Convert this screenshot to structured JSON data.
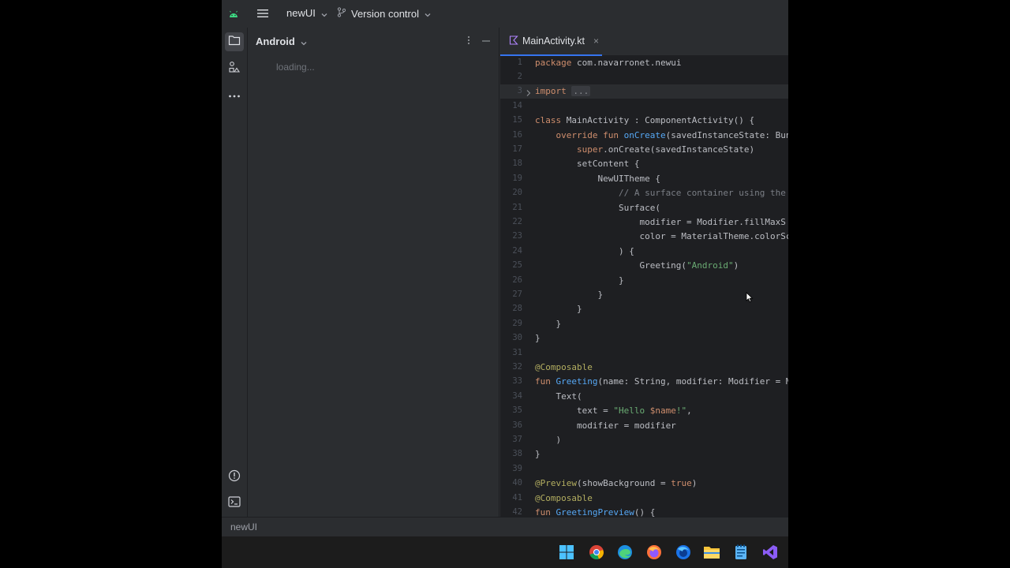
{
  "titlebar": {
    "project_name": "newUI",
    "vcs_label": "Version control"
  },
  "project_panel": {
    "view_label": "Android",
    "loading_text": "loading..."
  },
  "editor": {
    "tab_label": "MainActivity.kt",
    "tab_close": "×",
    "fold_ellipsis": "...",
    "line_numbers": [
      "1",
      "2",
      "3",
      "14",
      "15",
      "16",
      "17",
      "18",
      "19",
      "20",
      "21",
      "22",
      "23",
      "24",
      "25",
      "26",
      "27",
      "28",
      "29",
      "30",
      "31",
      "32",
      "33",
      "34",
      "35",
      "36",
      "37",
      "38",
      "39",
      "40",
      "41",
      "42"
    ],
    "code_lines": [
      [
        [
          "kw",
          "package "
        ],
        [
          "",
          "com.navarronet.newui"
        ]
      ],
      [],
      [
        [
          "kw",
          "import "
        ],
        [
          "ell",
          "..."
        ]
      ],
      [],
      [
        [
          "kw",
          "class "
        ],
        [
          "",
          "MainActivity : ComponentActivity() {"
        ]
      ],
      [
        [
          "",
          "    "
        ],
        [
          "kw",
          "override fun "
        ],
        [
          "fn",
          "onCreate"
        ],
        [
          "",
          "(savedInstanceState: Bun"
        ]
      ],
      [
        [
          "",
          "        "
        ],
        [
          "kw",
          "super"
        ],
        [
          "",
          ".onCreate(savedInstanceState)"
        ]
      ],
      [
        [
          "",
          "        setContent {"
        ]
      ],
      [
        [
          "",
          "            NewUITheme {"
        ]
      ],
      [
        [
          "cm",
          "                // A surface container using the"
        ]
      ],
      [
        [
          "",
          "                Surface("
        ]
      ],
      [
        [
          "",
          "                    modifier = Modifier.fillMaxS"
        ]
      ],
      [
        [
          "",
          "                    color = MaterialTheme.colorSc"
        ]
      ],
      [
        [
          "",
          "                ) {"
        ]
      ],
      [
        [
          "",
          "                    Greeting("
        ],
        [
          "st",
          "\"Android\""
        ],
        [
          "",
          ")"
        ]
      ],
      [
        [
          "",
          "                }"
        ]
      ],
      [
        [
          "",
          "            }"
        ]
      ],
      [
        [
          "",
          "        }"
        ]
      ],
      [
        [
          "",
          "    }"
        ]
      ],
      [
        [
          "",
          "}"
        ]
      ],
      [],
      [
        [
          "an",
          "@Composable"
        ]
      ],
      [
        [
          "kw",
          "fun "
        ],
        [
          "fn",
          "Greeting"
        ],
        [
          "",
          "(name: String, modifier: Modifier = M"
        ]
      ],
      [
        [
          "",
          "    Text("
        ]
      ],
      [
        [
          "",
          "        text = "
        ],
        [
          "st",
          "\"Hello "
        ],
        [
          "kw",
          "$name"
        ],
        [
          "st",
          "!\""
        ],
        [
          "",
          ","
        ]
      ],
      [
        [
          "",
          "        modifier = modifier"
        ]
      ],
      [
        [
          "",
          "    )"
        ]
      ],
      [
        [
          "",
          "}"
        ]
      ],
      [],
      [
        [
          "an",
          "@Preview"
        ],
        [
          "",
          "(showBackground = "
        ],
        [
          "kw",
          "true"
        ],
        [
          "",
          ")"
        ]
      ],
      [
        [
          "an",
          "@Composable"
        ]
      ],
      [
        [
          "kw",
          "fun "
        ],
        [
          "fn",
          "GreetingPreview"
        ],
        [
          "",
          "() {"
        ]
      ]
    ]
  },
  "statusbar": {
    "breadcrumb": "newUI"
  },
  "icons": {
    "android": "android-icon",
    "project": "folder-icon",
    "structure": "structure-icon",
    "more": "more-icon",
    "problems": "problems-icon",
    "terminal": "terminal-icon"
  },
  "colors": {
    "accent": "#3574f0",
    "keyword": "#cf8e6d",
    "string": "#6aab73",
    "comment": "#7a7e85",
    "annotation": "#b3ae60",
    "function": "#56a8f5"
  }
}
